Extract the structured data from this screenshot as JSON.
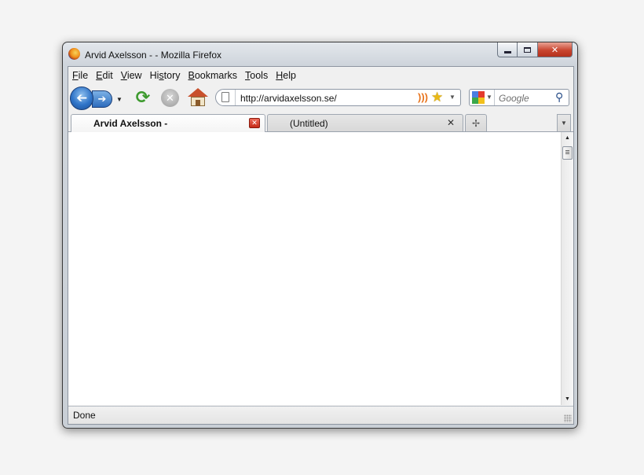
{
  "window": {
    "title": "Arvid Axelsson - - Mozilla Firefox"
  },
  "menu": [
    "File",
    "Edit",
    "View",
    "History",
    "Bookmarks",
    "Tools",
    "Help"
  ],
  "menu_underline": [
    "F",
    "E",
    "V",
    "s",
    "B",
    "T",
    "H"
  ],
  "navigation": {
    "url": "http://arvidaxelsson.se/",
    "search_placeholder": "Google",
    "icons": [
      "back-icon",
      "forward-icon",
      "reload-icon",
      "stop-icon",
      "home-icon",
      "rss-icon",
      "bookmark-star-icon",
      "search-engine-icon",
      "search-icon"
    ]
  },
  "tabs": [
    {
      "label": "Arvid Axelsson -",
      "active": true
    },
    {
      "label": "(Untitled)",
      "active": false
    }
  ],
  "status": {
    "text": "Done"
  },
  "colors": {
    "window_frame": "#cfd5dc",
    "close_button": "#c9452f",
    "accent_blue": "#2f74c8"
  }
}
